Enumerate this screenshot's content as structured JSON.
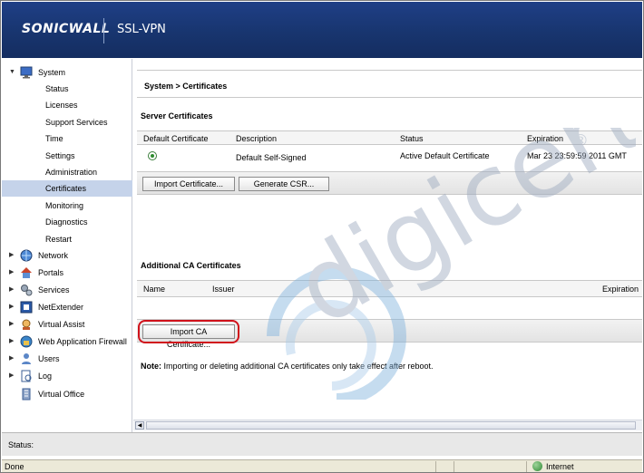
{
  "header": {
    "brand": "SONICWALL",
    "product": "SSL-VPN"
  },
  "sidebar": {
    "items": [
      {
        "label": "System",
        "level": 0,
        "expanded": true,
        "icon": "monitor-icon"
      },
      {
        "label": "Status",
        "level": 1
      },
      {
        "label": "Licenses",
        "level": 1
      },
      {
        "label": "Support Services",
        "level": 1
      },
      {
        "label": "Time",
        "level": 1
      },
      {
        "label": "Settings",
        "level": 1
      },
      {
        "label": "Administration",
        "level": 1
      },
      {
        "label": "Certificates",
        "level": 1,
        "selected": true
      },
      {
        "label": "Monitoring",
        "level": 1
      },
      {
        "label": "Diagnostics",
        "level": 1
      },
      {
        "label": "Restart",
        "level": 1
      },
      {
        "label": "Network",
        "level": 0,
        "icon": "globe-icon"
      },
      {
        "label": "Portals",
        "level": 0,
        "icon": "house-icon"
      },
      {
        "label": "Services",
        "level": 0,
        "icon": "gears-icon"
      },
      {
        "label": "NetExtender",
        "level": 0,
        "icon": "netextender-icon"
      },
      {
        "label": "Virtual Assist",
        "level": 0,
        "icon": "assist-icon"
      },
      {
        "label": "Web Application Firewall",
        "level": 0,
        "icon": "firewall-icon"
      },
      {
        "label": "Users",
        "level": 0,
        "icon": "users-icon"
      },
      {
        "label": "Log",
        "level": 0,
        "icon": "log-icon"
      },
      {
        "label": "Virtual Office",
        "level": 0,
        "icon": "office-icon",
        "no_arrow": true
      }
    ]
  },
  "content": {
    "breadcrumb": "System > Certificates",
    "server": {
      "title": "Server Certificates",
      "columns": [
        "Default Certificate",
        "Description",
        "Status",
        "Expiration"
      ],
      "rows": [
        {
          "description": "Default Self-Signed",
          "status": "Active Default Certificate",
          "expiration": "Mar 23 23:59:59 2011 GMT"
        }
      ],
      "buttons": {
        "import": "Import Certificate...",
        "csr": "Generate CSR..."
      }
    },
    "ca": {
      "title": "Additional CA Certificates",
      "columns": [
        "Name",
        "Issuer",
        "Expiration"
      ],
      "buttons": {
        "import": "Import CA Certificate..."
      }
    },
    "note": {
      "bold": "Note:",
      "text": " Importing or deleting additional CA certificates only take effect after reboot."
    }
  },
  "status": {
    "label": "Status:"
  },
  "browser": {
    "done": "Done",
    "zone": "Internet"
  },
  "watermark": {
    "text": "digicert",
    "mark": "®"
  }
}
